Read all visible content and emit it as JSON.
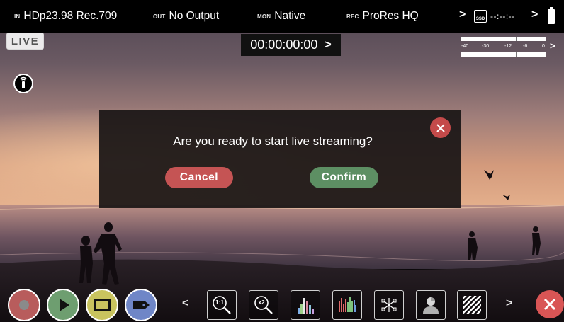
{
  "topbar": {
    "input_prefix": "IN",
    "input_value": "HDp23.98 Rec.709",
    "output_prefix": "OUT",
    "output_value": "No Output",
    "monitor_prefix": "MON",
    "monitor_value": "Native",
    "record_prefix": "REC",
    "record_value": "ProRes HQ",
    "media_label": "SSD",
    "media_time": "--:--:--",
    "arrow": ">"
  },
  "live_badge": "LIVE",
  "timecode": {
    "value": "00:00:00:00",
    "arrow": ">"
  },
  "audio_meter": {
    "scale": [
      "-40",
      "-30",
      "-12",
      "-6",
      "0"
    ],
    "arrow": ">"
  },
  "dialog": {
    "question": "Are you ready to start live streaming?",
    "cancel_label": "Cancel",
    "confirm_label": "Confirm"
  },
  "toolbar": {
    "left_arrow": "<",
    "right_arrow": ">",
    "zoom_1to1_label": "1:1",
    "zoom_x2_label": "x2",
    "colors": {
      "record": "#b85c5c",
      "play": "#6e9e70",
      "monitor": "#c9c35e",
      "tag": "#6f86c7",
      "close": "#d95555"
    }
  }
}
